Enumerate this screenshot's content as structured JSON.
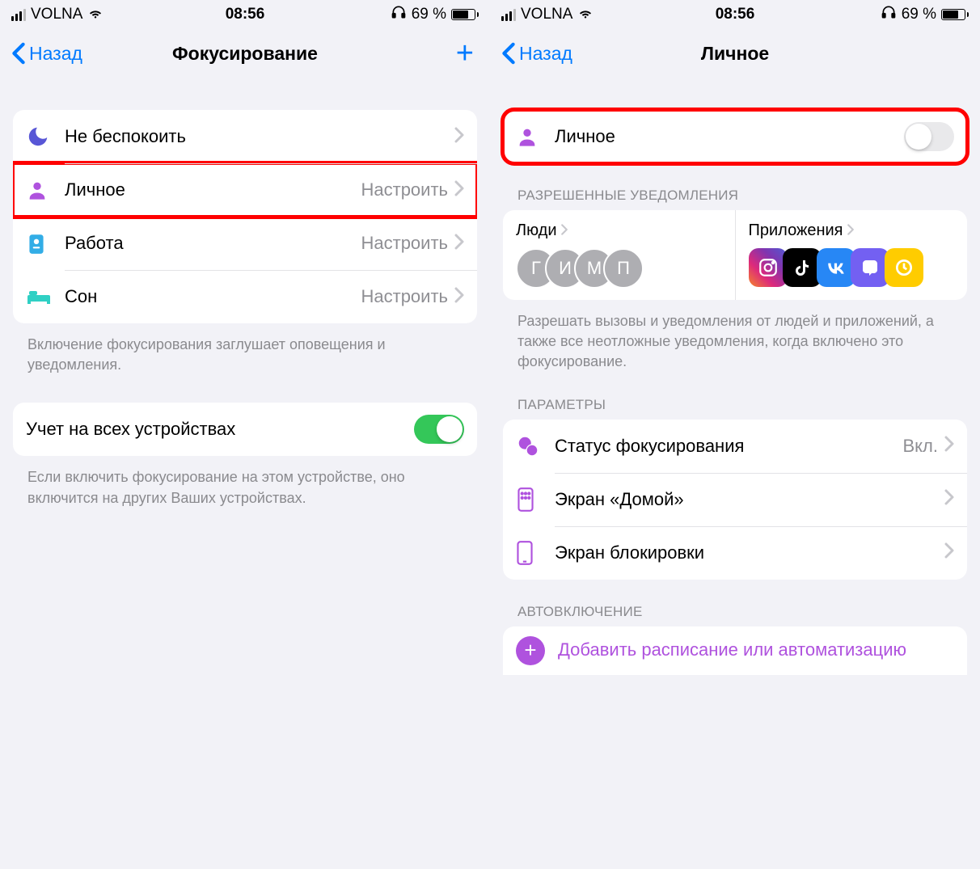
{
  "status": {
    "carrier": "VOLNA",
    "time": "08:56",
    "battery_pct": "69 %"
  },
  "left": {
    "back": "Назад",
    "title": "Фокусирование",
    "rows": {
      "dnd": "Не беспокоить",
      "personal": "Личное",
      "work": "Работа",
      "sleep": "Сон",
      "configure": "Настроить"
    },
    "footer1": "Включение фокусирования заглушает оповещения и уведомления.",
    "share": "Учет на всех устройствах",
    "footer2": "Если включить фокусирование на этом устройстве, оно включится на других Ваших устройствах."
  },
  "right": {
    "back": "Назад",
    "title": "Личное",
    "personal": "Личное",
    "allowed_header": "РАЗРЕШЕННЫЕ УВЕДОМЛЕНИЯ",
    "people": "Люди",
    "apps": "Приложения",
    "avatars": [
      "Г",
      "И",
      "М",
      "П"
    ],
    "allowed_footer": "Разрешать вызовы и уведомления от людей и приложений, а также все неотложные уведомления, когда включено это фокусирование.",
    "params_header": "ПАРАМЕТРЫ",
    "focus_status": "Статус фокусирования",
    "focus_status_val": "Вкл.",
    "home_screen": "Экран «Домой»",
    "lock_screen": "Экран блокировки",
    "auto_header": "АВТОВКЛЮЧЕНИЕ",
    "add_schedule": "Добавить расписание или автоматизацию"
  }
}
